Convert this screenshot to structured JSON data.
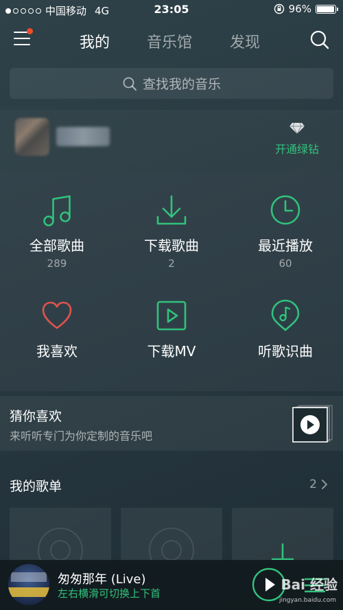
{
  "status_bar": {
    "carrier": "中国移动",
    "network": "4G",
    "time": "23:05",
    "battery": "96%",
    "battery_level": 0.96
  },
  "header": {
    "tabs": [
      {
        "label": "我的",
        "active": true
      },
      {
        "label": "音乐馆",
        "active": false
      },
      {
        "label": "发现",
        "active": false
      }
    ],
    "menu_icon": "hamburger-menu-icon",
    "search_icon": "search-icon"
  },
  "search": {
    "placeholder": "查找我的音乐"
  },
  "profile": {
    "vip_label": "开通绿钻",
    "vip_icon": "diamond-icon"
  },
  "grid": [
    {
      "label": "全部歌曲",
      "count": "289",
      "icon": "music-note-icon"
    },
    {
      "label": "下载歌曲",
      "count": "2",
      "icon": "download-icon"
    },
    {
      "label": "最近播放",
      "count": "60",
      "icon": "clock-icon"
    },
    {
      "label": "我喜欢",
      "icon": "heart-icon"
    },
    {
      "label": "下载MV",
      "icon": "video-play-icon"
    },
    {
      "label": "听歌识曲",
      "icon": "music-recognition-icon"
    }
  ],
  "guess": {
    "title": "猜你喜欢",
    "subtitle": "来听听专门为你定制的音乐吧"
  },
  "playlists": {
    "title": "我的歌单",
    "count": "2"
  },
  "player": {
    "song_title": "匆匆那年 (Live)",
    "hint": "左右横滑可切换上下首"
  },
  "watermark": {
    "text": "Bai 经验",
    "url": "jingyan.baidu.com"
  },
  "colors": {
    "accent_green": "#31c27c",
    "heart_red": "#e0534e",
    "notification_dot": "#ef4a2b"
  }
}
